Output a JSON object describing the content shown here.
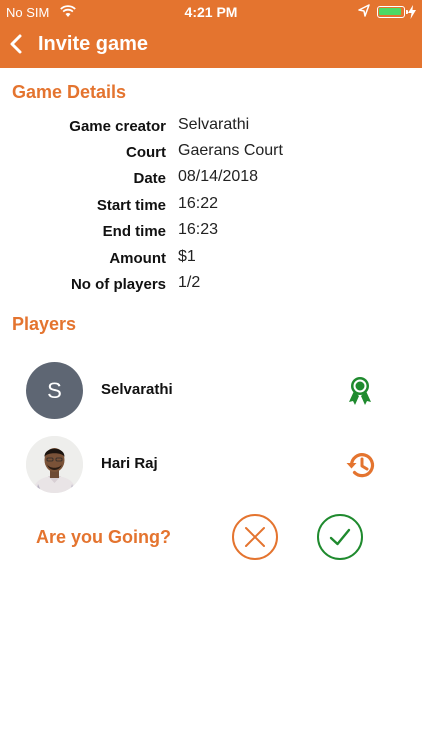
{
  "status_bar": {
    "carrier": "No SIM",
    "time": "4:21 PM"
  },
  "nav": {
    "title": "Invite game"
  },
  "details": {
    "section_title": "Game Details",
    "rows": [
      {
        "label": "Game creator",
        "value": "Selvarathi"
      },
      {
        "label": "Court",
        "value": "Gaerans Court"
      },
      {
        "label": "Date",
        "value": "08/14/2018"
      },
      {
        "label": "Start time",
        "value": "16:22"
      },
      {
        "label": "End time",
        "value": "16:23"
      },
      {
        "label": "Amount",
        "value": "$1"
      },
      {
        "label": "No of players",
        "value": "1/2"
      }
    ]
  },
  "players": {
    "section_title": "Players",
    "list": [
      {
        "initial": "S",
        "name": "Selvarathi",
        "status_icon": "award-ribbon-icon"
      },
      {
        "initial": "",
        "name": "Hari Raj",
        "status_icon": "history-icon"
      }
    ]
  },
  "rsvp": {
    "question": "Are you Going?"
  },
  "colors": {
    "accent": "#e4742f",
    "accept": "#1f8a2e",
    "avatar_bg": "#5e6673"
  }
}
